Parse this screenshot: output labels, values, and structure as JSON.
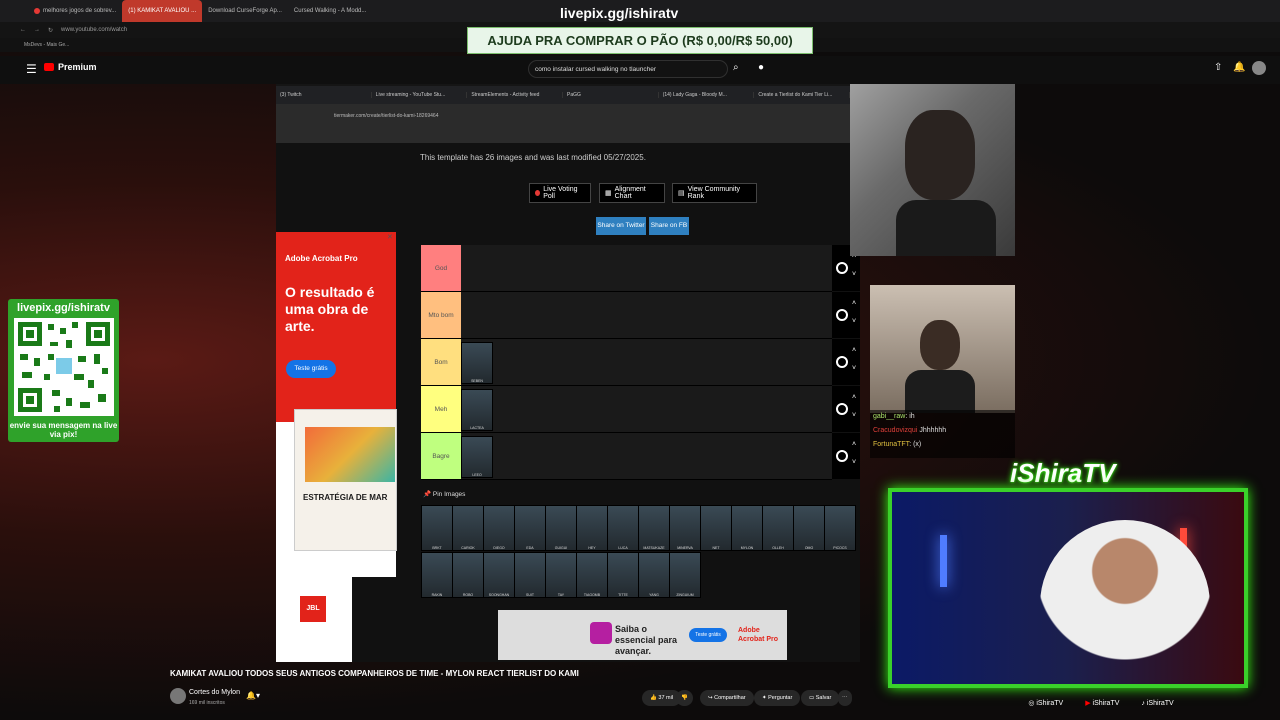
{
  "browser": {
    "tabs": [
      "melhores jogos de sobrev...",
      "(1) KAMIKAT AVALIOU ...",
      "Download CurseForge Ap...",
      "Cursed Walking - A Modd..."
    ],
    "url": "www.youtube.com/watch",
    "bookmark": "MsDevs - Mais Ge..."
  },
  "overlay": {
    "title": "livepix.gg/ishiratv",
    "pix_goal": "AJUDA PRA COMPRAR O PÃO (R$ 0,00/R$ 50,00)"
  },
  "youtube": {
    "logo": "Premium",
    "search_value": "como instalar cursed walking no tlauncher",
    "video_title": "KAMIKAT AVALIOU TODOS SEUS ANTIGOS COMPANHEIROS DE TIME - MYLON REACT TIERLIST DO KAMI",
    "channel": "Cortes do Mylon",
    "subscribers": "169 mil inscritos",
    "likes": "37 mil",
    "share": "Compartilhar",
    "ask": "Perguntar",
    "save": "Salvar"
  },
  "inner": {
    "tabs": [
      "(3) Twitch",
      "Live streaming - YouTube Stu...",
      "StreamElements - Activity feed",
      "PaGG",
      "(14) Lady Gaga - Bloody M...",
      "Create a Tierlist do Kami Tier Li..."
    ],
    "url": "tiermaker.com/create/tierlist-do-kami-18269464",
    "template_info": "This template has 26 images and was last modified 05/27/2025.",
    "buttons": [
      "Live Voting Poll",
      "Alignment Chart",
      "View Community Rank"
    ],
    "share_twitter": "Share on Twitter",
    "share_fb": "Share on FB",
    "tiers": [
      {
        "label": "God",
        "color": "#ff7f7f",
        "players": []
      },
      {
        "label": "Mto bom",
        "color": "#ffbf7f",
        "players": []
      },
      {
        "label": "Bom",
        "color": "#ffdf7f",
        "players": [
          "SEBEN"
        ]
      },
      {
        "label": "Meh",
        "color": "#ffff7f",
        "players": [
          "LACTEA"
        ]
      },
      {
        "label": "Bagre",
        "color": "#bfff7f",
        "players": [
          "LEEO"
        ]
      }
    ],
    "pin_title": "Pin Images",
    "pool_row1": [
      "BRKT",
      "CARIOK",
      "DIEGO",
      "EDA",
      "GUIGUI",
      "HEY",
      "LUCA",
      "MATSUKAZE",
      "MINERVA",
      "NET",
      "MYLON",
      "OLLEH",
      "OMO",
      "PICOCS"
    ],
    "pool_row2": [
      "RAKIN",
      "ROBO",
      "SOONGHAN",
      "SUIT",
      "TAY",
      "TIAGOMB",
      "TITTE",
      "YANG",
      "ZINGUIUM"
    ],
    "ad_brand": "Adobe Acrobat Pro",
    "ad_headline": "O resultado é uma obra de arte.",
    "ad_cta": "Teste grátis",
    "ad_book": "ESTRATÉGIA DE MAR",
    "jbl": "JBL",
    "bottom_ad_text": "Saiba o essencial para avançar.",
    "bottom_ad_cta": "Teste grátis",
    "bottom_ad_brand": "Adobe Acrobat Pro"
  },
  "qr": {
    "title": "livepix.gg/ishiratv",
    "footer": "envie sua mensagem na live via pix!"
  },
  "chat": [
    {
      "user": "gabi__raw",
      "msg": "ih",
      "color": "#a8e06a"
    },
    {
      "user": "Cracudovizqui",
      "msg": "Jhhhhhh",
      "color": "#e0403a"
    },
    {
      "user": "FortunaTFT",
      "msg": "(x)",
      "color": "#e0c040"
    }
  ],
  "frame": {
    "title": "iShiraTV",
    "socials": [
      "iShiraTV",
      "iShiraTV",
      "iShiraTV"
    ]
  }
}
